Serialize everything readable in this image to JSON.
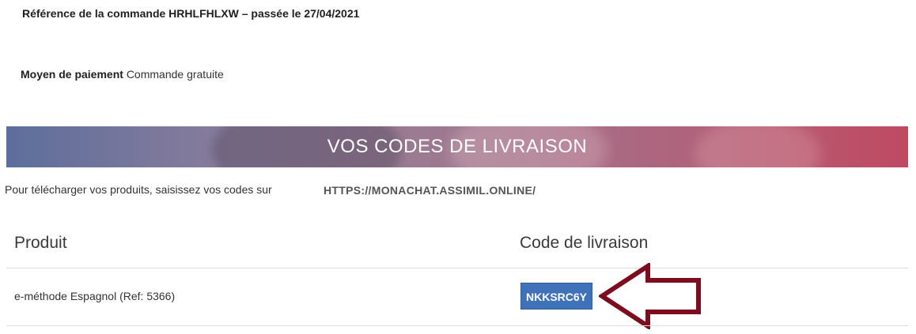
{
  "order": {
    "reference_text": "Référence de la commande HRHLFHLXW – passée le 27/04/2021"
  },
  "payment": {
    "label": "Moyen de paiement",
    "value": "Commande gratuite"
  },
  "banner": {
    "title": "VOS CODES DE LIVRAISON"
  },
  "instructions": {
    "text": "Pour télécharger vos produits, saisissez vos codes sur",
    "url": "HTTPS://MONACHAT.ASSIMIL.ONLINE/"
  },
  "table": {
    "headers": {
      "product": "Produit",
      "code": "Code de livraison"
    },
    "rows": [
      {
        "product": "e-méthode Espagnol (Ref: 5366)",
        "code": "NKKSRC6Y"
      }
    ]
  },
  "colors": {
    "code_badge": "#3f72b8",
    "arrow": "#7b0d1e"
  },
  "icons": {
    "annotation_arrow": "left-arrow-outline"
  }
}
